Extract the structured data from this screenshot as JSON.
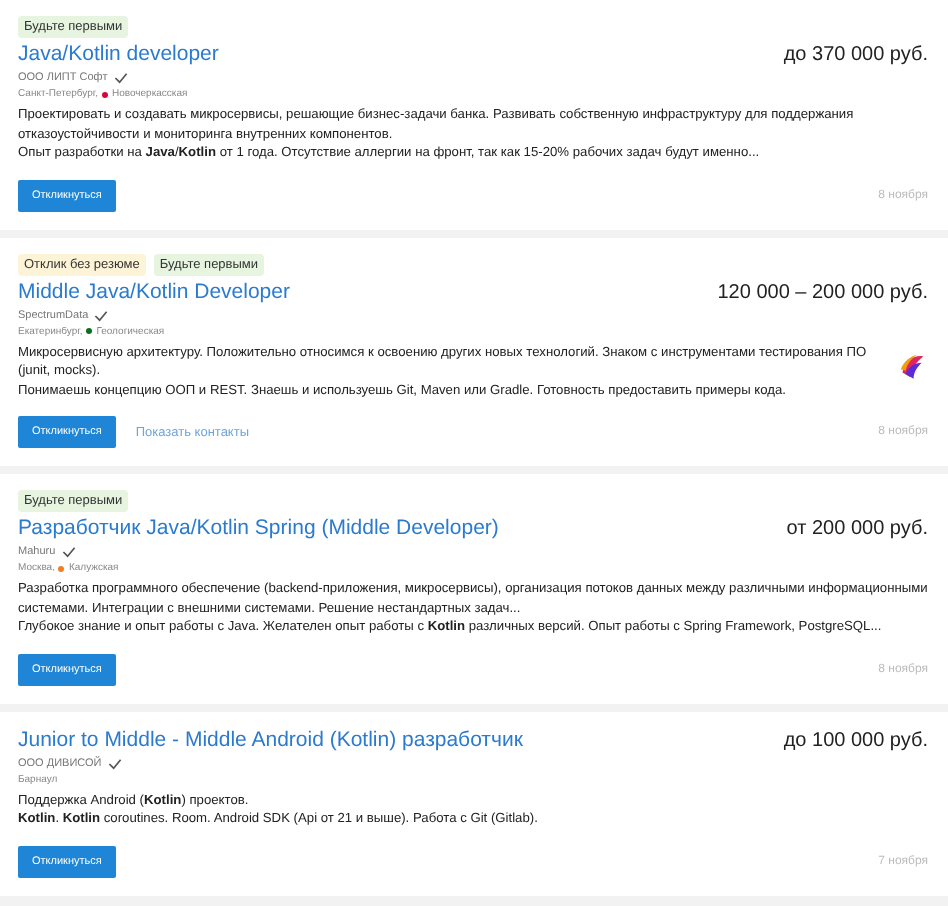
{
  "vacancies": [
    {
      "tags": [
        {
          "kind": "first",
          "label": "Будьте первыми"
        }
      ],
      "title": "Java/Kotlin developer",
      "salary": "до 370 000 руб.",
      "company": "ООО ЛИПТ Софт",
      "verified": true,
      "city": "Санкт-Петербург,",
      "metro": {
        "name": "Новочеркасская",
        "color": "#d6083b"
      },
      "paragraphs": [
        "Проектировать и создавать микросервисы, решающие бизнес-задачи банка. Развивать собственную инфраструктуру для поддержания отказоустойчивости и мониторинга внутренних компонентов.",
        "Опыт разработки на **Java**/**Kotlin** от 1 года. Отсутствие аллергии на фронт, так как 15-20% рабочих задач будут именно..."
      ],
      "logo": false,
      "apply": "Откликнуться",
      "date": "8 ноября"
    },
    {
      "tags": [
        {
          "kind": "no-resume",
          "label": "Отклик без резюме"
        },
        {
          "kind": "first",
          "label": "Будьте первыми"
        }
      ],
      "title": "Middle Java/Kotlin Developer",
      "salary": "120 000 – 200 000 руб.",
      "company": "SpectrumData",
      "verified": true,
      "city": "Екатеринбург,",
      "metro": {
        "name": "Геологическая",
        "color": "#0a6f20"
      },
      "paragraphs": [
        "Микросервисную архитектуру. Положительно относимся к освоению других новых технологий. Знаком с инструментами тестирования ПО (junit, mocks).",
        "Понимаешь концепцию ООП и REST. Знаешь и используешь Git, Maven или Gradle. Готовность предоставить примеры кода."
      ],
      "logo": true,
      "apply": "Откликнуться",
      "contacts": "Показать контакты",
      "date": "8 ноября"
    },
    {
      "tags": [
        {
          "kind": "first",
          "label": "Будьте первыми"
        }
      ],
      "title": "Разработчик Java/Kotlin Spring (Middle Developer)",
      "salary": "от 200 000 руб.",
      "company": "Mahuru",
      "verified": true,
      "city": "Москва,",
      "metro": {
        "name": "Калужская",
        "color": "#f07e24"
      },
      "paragraphs": [
        "Разработка программного обеспечение (backend-приложения, микросервисы), организация потоков данных между различными информационными системами. Интеграции с внешними системами. Решение нестандартных задач...",
        "Глубокое знание и опыт работы с Java. Желателен опыт работы с **Kotlin** различных версий. Опыт работы с Spring Framework, PostgreSQL..."
      ],
      "logo": false,
      "apply": "Откликнуться",
      "date": "8 ноября"
    },
    {
      "title": "Junior to Middle - Middle Android (Kotlin) разработчик",
      "salary": "до 100 000 руб.",
      "company": "ООО ДИВИСОЙ",
      "verified": true,
      "city": "Барнаул",
      "paragraphs": [
        "Поддержка Android (**Kotlin**) проектов.",
        "**Kotlin**. **Kotlin** coroutines. Room. Android SDK (Api от 21 и выше). Работа с Git (Gitlab)."
      ],
      "logo": false,
      "apply": "Откликнуться",
      "date": "7 ноября"
    }
  ]
}
